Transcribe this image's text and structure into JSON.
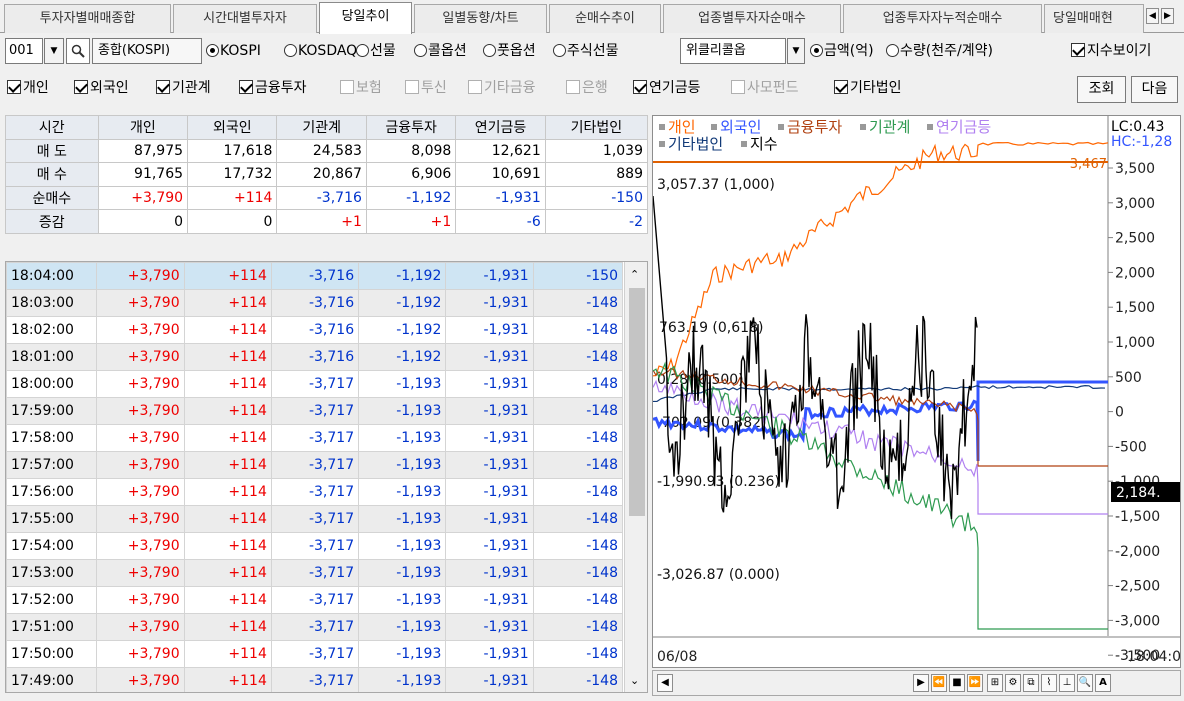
{
  "tabs": [
    "투자자별매매종합",
    "시간대별투자자",
    "당일추이",
    "일별동향/차트",
    "순매수추이",
    "업종별투자자순매수",
    "업종투자자누적순매수",
    "당일매매현"
  ],
  "active_tab": 2,
  "toolbar": {
    "code": "001",
    "market_name": "종합(KOSPI)",
    "market_radios": [
      "KOSPI",
      "KOSDAQ",
      "선물",
      "콜옵션",
      "풋옵션",
      "주식선물"
    ],
    "market_selected": 0,
    "weekly_select": "위클리콜옵",
    "unit_radios": [
      "금액(억)",
      "수량(천주/계약)"
    ],
    "unit_selected": 0,
    "show_index_label": "지수보이기",
    "show_index_checked": true
  },
  "investor_checks": [
    {
      "label": "개인",
      "checked": true
    },
    {
      "label": "외국인",
      "checked": true
    },
    {
      "label": "기관계",
      "checked": true
    },
    {
      "label": "금융투자",
      "checked": true
    },
    {
      "label": "보험",
      "checked": false
    },
    {
      "label": "투신",
      "checked": false
    },
    {
      "label": "기타금융",
      "checked": false
    },
    {
      "label": "은행",
      "checked": false
    },
    {
      "label": "연기금등",
      "checked": true
    },
    {
      "label": "사모펀드",
      "checked": false
    },
    {
      "label": "기타법인",
      "checked": true
    }
  ],
  "buttons": {
    "query": "조회",
    "next": "다음"
  },
  "summary": {
    "headers": [
      "시간",
      "개인",
      "외국인",
      "기관계",
      "금융투자",
      "연기금등",
      "기타법인"
    ],
    "rows": [
      {
        "label": "매 도",
        "values": [
          "87,975",
          "17,618",
          "24,583",
          "8,098",
          "12,621",
          "1,039"
        ]
      },
      {
        "label": "매 수",
        "values": [
          "91,765",
          "17,732",
          "20,867",
          "6,906",
          "10,691",
          "889"
        ]
      },
      {
        "label": "순매수",
        "values": [
          "+3,790",
          "+114",
          "-3,716",
          "-1,192",
          "-1,931",
          "-150"
        ]
      },
      {
        "label": "증감",
        "values": [
          "0",
          "0",
          "+1",
          "+1",
          "-6",
          "-2"
        ]
      }
    ]
  },
  "list": [
    [
      "18:04:00",
      "+3,790",
      "+114",
      "-3,716",
      "-1,192",
      "-1,931",
      "-150"
    ],
    [
      "18:03:00",
      "+3,790",
      "+114",
      "-3,716",
      "-1,192",
      "-1,931",
      "-148"
    ],
    [
      "18:02:00",
      "+3,790",
      "+114",
      "-3,716",
      "-1,192",
      "-1,931",
      "-148"
    ],
    [
      "18:01:00",
      "+3,790",
      "+114",
      "-3,716",
      "-1,192",
      "-1,931",
      "-148"
    ],
    [
      "18:00:00",
      "+3,790",
      "+114",
      "-3,717",
      "-1,193",
      "-1,931",
      "-148"
    ],
    [
      "17:59:00",
      "+3,790",
      "+114",
      "-3,717",
      "-1,193",
      "-1,931",
      "-148"
    ],
    [
      "17:58:00",
      "+3,790",
      "+114",
      "-3,717",
      "-1,193",
      "-1,931",
      "-148"
    ],
    [
      "17:57:00",
      "+3,790",
      "+114",
      "-3,717",
      "-1,193",
      "-1,931",
      "-148"
    ],
    [
      "17:56:00",
      "+3,790",
      "+114",
      "-3,717",
      "-1,193",
      "-1,931",
      "-148"
    ],
    [
      "17:55:00",
      "+3,790",
      "+114",
      "-3,717",
      "-1,193",
      "-1,931",
      "-148"
    ],
    [
      "17:54:00",
      "+3,790",
      "+114",
      "-3,717",
      "-1,193",
      "-1,931",
      "-148"
    ],
    [
      "17:53:00",
      "+3,790",
      "+114",
      "-3,717",
      "-1,193",
      "-1,931",
      "-148"
    ],
    [
      "17:52:00",
      "+3,790",
      "+114",
      "-3,717",
      "-1,193",
      "-1,931",
      "-148"
    ],
    [
      "17:51:00",
      "+3,790",
      "+114",
      "-3,717",
      "-1,193",
      "-1,931",
      "-148"
    ],
    [
      "17:50:00",
      "+3,790",
      "+114",
      "-3,717",
      "-1,193",
      "-1,931",
      "-148"
    ],
    [
      "17:49:00",
      "+3,790",
      "+114",
      "-3,717",
      "-1,193",
      "-1,931",
      "-148"
    ]
  ],
  "chart": {
    "legend": [
      {
        "name": "개인",
        "color": "#ff6600"
      },
      {
        "name": "외국인",
        "color": "#3355ff"
      },
      {
        "name": "금융투자",
        "color": "#b04010"
      },
      {
        "name": "기관계",
        "color": "#2e9a50"
      },
      {
        "name": "연기금등",
        "color": "#b080f0"
      },
      {
        "name": "기타법인",
        "color": "#123a78"
      },
      {
        "name": "지수",
        "color": "#000000"
      }
    ],
    "lc": "LC:0.43",
    "hc": "HC:-1,28",
    "y_ticks": [
      "3,500",
      "3,000",
      "2,500",
      "2,000",
      "1,500",
      "1,000",
      "500",
      "0",
      "-500",
      "-1,000",
      "-1,500",
      "-2,000",
      "-2,500",
      "-3,000",
      "-3,500"
    ],
    "fib": [
      "3,057.37 (1,000)",
      "763.19 (0,618)",
      "0.28 (0.500)",
      "-702.09 (0.382)",
      "-1,990.93 (0.236)",
      "-3,026.87 (0.000)"
    ],
    "last_value": "3,467",
    "index_value": "2,184.",
    "date": "06/08",
    "time": "18:04:0"
  }
}
